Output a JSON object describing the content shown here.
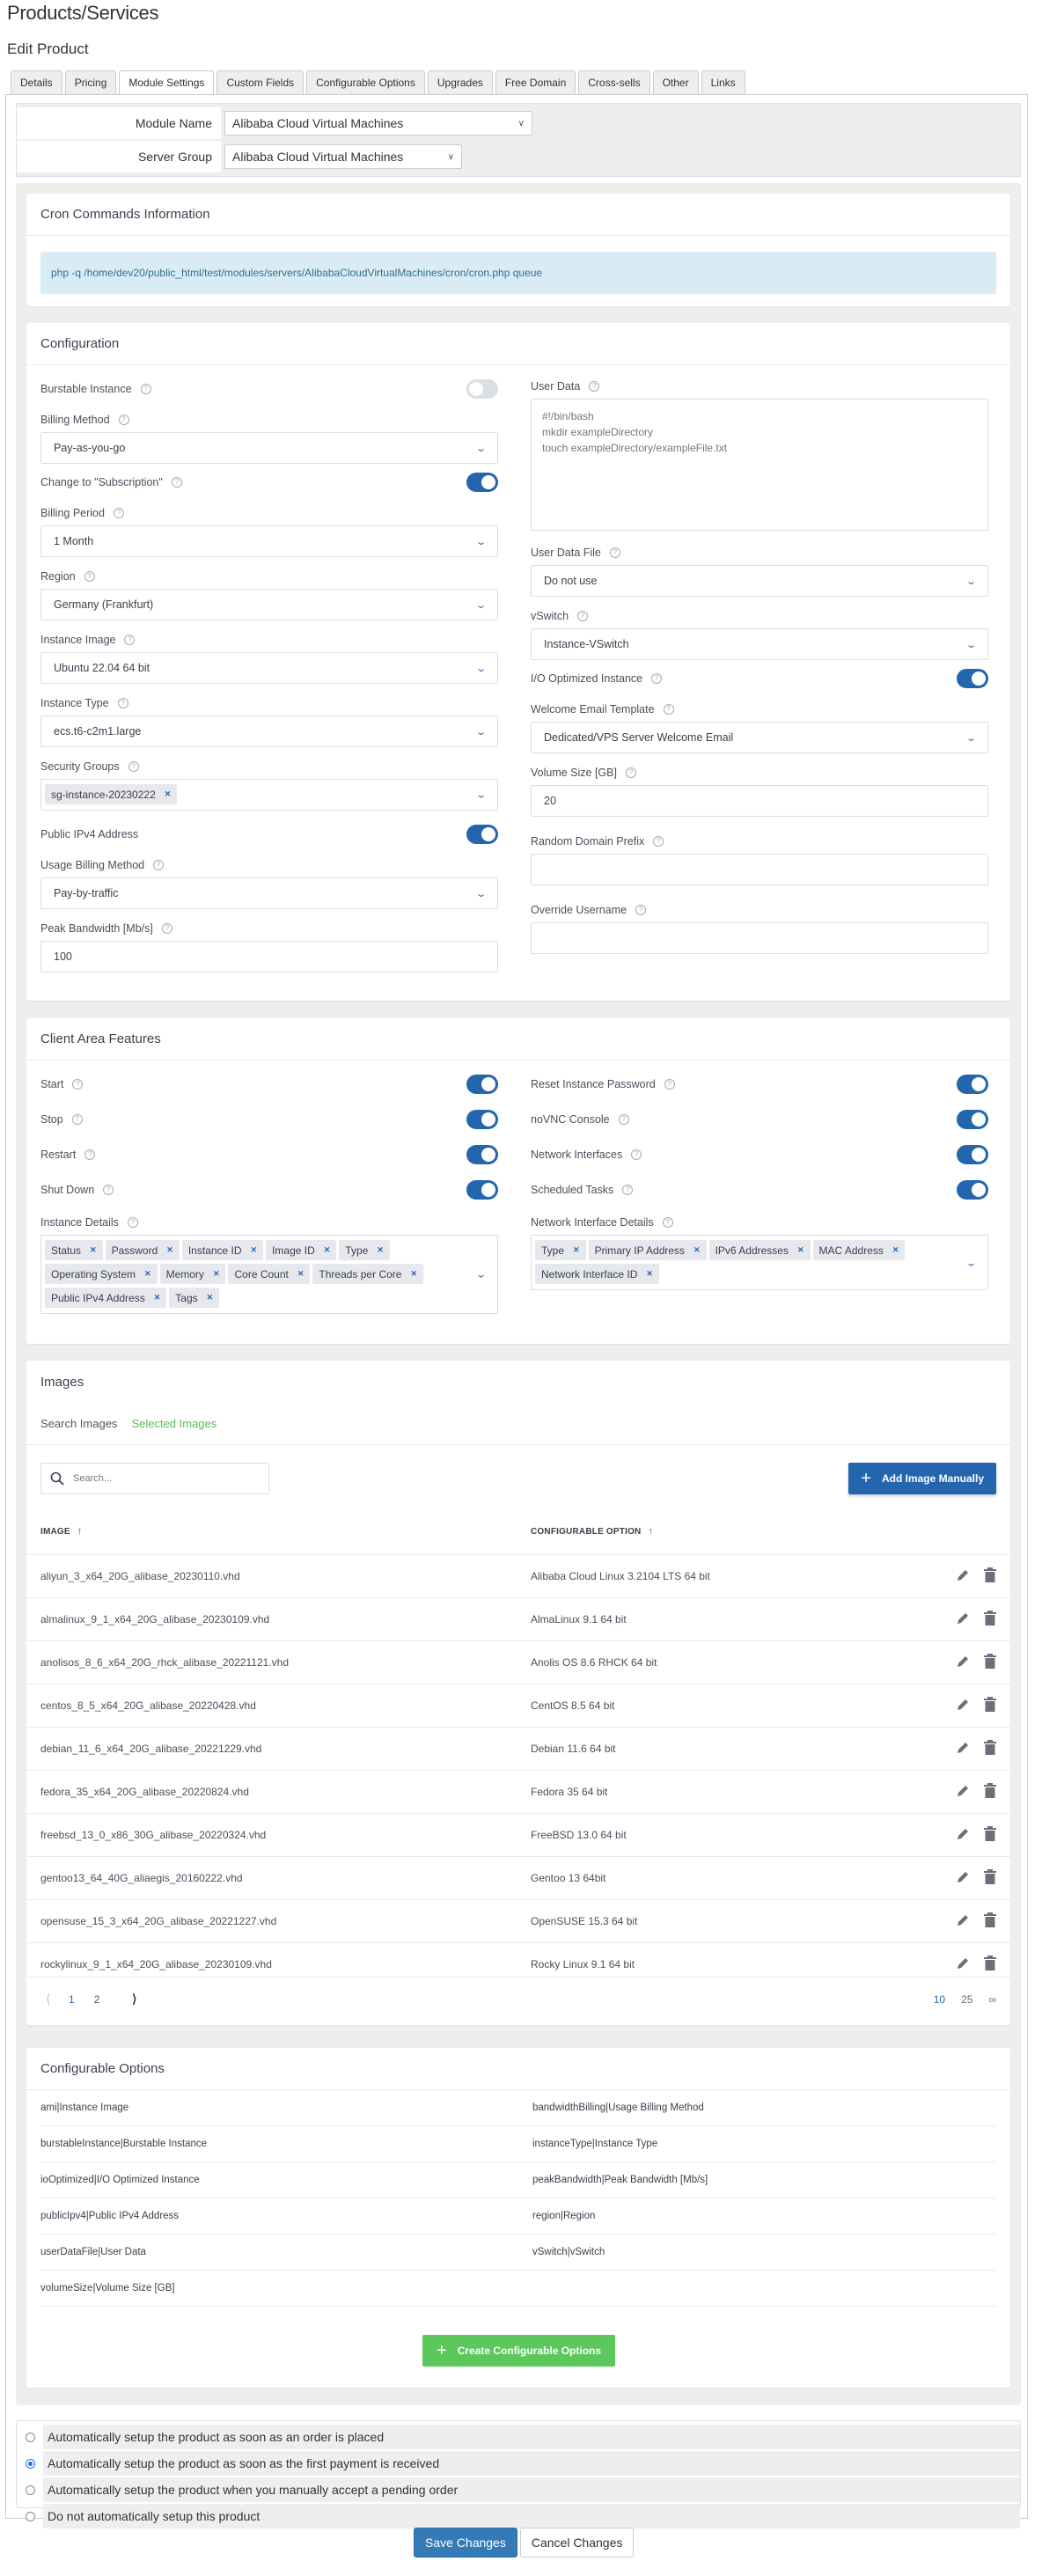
{
  "header": {
    "title": "Products/Services",
    "subtitle": "Edit Product"
  },
  "tabs": [
    {
      "label": "Details"
    },
    {
      "label": "Pricing"
    },
    {
      "label": "Module Settings",
      "active": true
    },
    {
      "label": "Custom Fields"
    },
    {
      "label": "Configurable Options"
    },
    {
      "label": "Upgrades"
    },
    {
      "label": "Free Domain"
    },
    {
      "label": "Cross-sells"
    },
    {
      "label": "Other"
    },
    {
      "label": "Links"
    }
  ],
  "module": {
    "module_name_label": "Module Name",
    "module_name_value": "Alibaba Cloud Virtual Machines",
    "server_group_label": "Server Group",
    "server_group_value": "Alibaba Cloud Virtual Machines"
  },
  "cron": {
    "title": "Cron Commands Information",
    "command": "php -q /home/dev20/public_html/test/modules/servers/AlibabaCloudVirtualMachines/cron/cron.php queue"
  },
  "configuration": {
    "title": "Configuration",
    "burstable": {
      "label": "Burstable Instance",
      "on": false
    },
    "billing_method": {
      "label": "Billing Method",
      "value": "Pay-as-you-go"
    },
    "change_subscription": {
      "label": "Change to \"Subscription\"",
      "on": true
    },
    "billing_period": {
      "label": "Billing Period",
      "value": "1 Month"
    },
    "region": {
      "label": "Region",
      "value": "Germany (Frankfurt)"
    },
    "instance_image": {
      "label": "Instance Image",
      "value": "Ubuntu 22.04 64 bit"
    },
    "instance_type": {
      "label": "Instance Type",
      "value": "ecs.t6-c2m1.large"
    },
    "security_groups": {
      "label": "Security Groups",
      "chips": [
        "sg-instance-20230222"
      ]
    },
    "public_ipv4": {
      "label": "Public IPv4 Address",
      "on": true
    },
    "usage_billing": {
      "label": "Usage Billing Method",
      "value": "Pay-by-traffic"
    },
    "peak_bandwidth": {
      "label": "Peak Bandwidth [Mb/s]",
      "value": "100"
    },
    "user_data": {
      "label": "User Data",
      "placeholder": "#!/bin/bash\nmkdir exampleDirectory\ntouch exampleDirectory/exampleFile.txt"
    },
    "user_data_file": {
      "label": "User Data File",
      "value": "Do not use"
    },
    "vswitch": {
      "label": "vSwitch",
      "value": "Instance-VSwitch"
    },
    "io_optimized": {
      "label": "I/O Optimized Instance",
      "on": true
    },
    "welcome_email": {
      "label": "Welcome Email Template",
      "value": "Dedicated/VPS Server Welcome Email"
    },
    "volume_size": {
      "label": "Volume Size [GB]",
      "value": "20"
    },
    "random_domain": {
      "label": "Random Domain Prefix",
      "value": ""
    },
    "override_username": {
      "label": "Override Username",
      "value": ""
    }
  },
  "client_area": {
    "title": "Client Area Features",
    "left_toggles": [
      {
        "label": "Start",
        "on": true
      },
      {
        "label": "Stop",
        "on": true
      },
      {
        "label": "Restart",
        "on": true
      },
      {
        "label": "Shut Down",
        "on": true
      }
    ],
    "right_toggles": [
      {
        "label": "Reset Instance Password",
        "on": true
      },
      {
        "label": "noVNC Console",
        "on": true
      },
      {
        "label": "Network Interfaces",
        "on": true
      },
      {
        "label": "Scheduled Tasks",
        "on": true
      }
    ],
    "instance_details": {
      "label": "Instance Details",
      "chips": [
        "Status",
        "Password",
        "Instance ID",
        "Image ID",
        "Type",
        "Operating System",
        "Memory",
        "Core Count",
        "Threads per Core",
        "Public IPv4 Address",
        "Tags"
      ]
    },
    "network_details": {
      "label": "Network Interface Details",
      "chips": [
        "Type",
        "Primary IP Address",
        "IPv6 Addresses",
        "MAC Address",
        "Network Interface ID"
      ]
    }
  },
  "images": {
    "title": "Images",
    "tabs": [
      {
        "label": "Search Images"
      },
      {
        "label": "Selected Images",
        "active": true
      }
    ],
    "search_placeholder": "Search...",
    "add_button": "Add Image Manually",
    "col_image": "IMAGE",
    "col_option": "CONFIGURABLE OPTION",
    "rows": [
      {
        "image": "aliyun_3_x64_20G_alibase_20230110.vhd",
        "option": "Alibaba Cloud Linux 3.2104 LTS 64 bit"
      },
      {
        "image": "almalinux_9_1_x64_20G_alibase_20230109.vhd",
        "option": "AlmaLinux 9.1 64 bit"
      },
      {
        "image": "anolisos_8_6_x64_20G_rhck_alibase_20221121.vhd",
        "option": "Anolis OS 8.6 RHCK 64 bit"
      },
      {
        "image": "centos_8_5_x64_20G_alibase_20220428.vhd",
        "option": "CentOS 8.5 64 bit"
      },
      {
        "image": "debian_11_6_x64_20G_alibase_20221229.vhd",
        "option": "Debian 11.6 64 bit"
      },
      {
        "image": "fedora_35_x64_20G_alibase_20220824.vhd",
        "option": "Fedora 35 64 bit"
      },
      {
        "image": "freebsd_13_0_x86_30G_alibase_20220324.vhd",
        "option": "FreeBSD 13.0 64 bit"
      },
      {
        "image": "gentoo13_64_40G_aliaegis_20160222.vhd",
        "option": "Gentoo 13 64bit"
      },
      {
        "image": "opensuse_15_3_x64_20G_alibase_20221227.vhd",
        "option": "OpenSUSE 15.3 64 bit"
      },
      {
        "image": "rockylinux_9_1_x64_20G_alibase_20230109.vhd",
        "option": "Rocky Linux 9.1 64 bit"
      }
    ],
    "pagination": {
      "pages": [
        "1",
        "2"
      ],
      "current": "1",
      "page_sizes": [
        "10",
        "25",
        "∞"
      ],
      "current_size": "10"
    }
  },
  "configurable_options": {
    "title": "Configurable Options",
    "items": [
      "ami|Instance Image",
      "bandwidthBilling|Usage Billing Method",
      "burstableInstance|Burstable Instance",
      "instanceType|Instance Type",
      "ioOptimized|I/O Optimized Instance",
      "peakBandwidth|Peak Bandwidth [Mb/s]",
      "publicIpv4|Public IPv4 Address",
      "region|Region",
      "userDataFile|User Data",
      "vSwitch|vSwitch",
      "volumeSize|Volume Size [GB]"
    ],
    "create_button": "Create Configurable Options"
  },
  "setup_options": [
    {
      "label": "Automatically setup the product as soon as an order is placed",
      "checked": false
    },
    {
      "label": "Automatically setup the product as soon as the first payment is received",
      "checked": true
    },
    {
      "label": "Automatically setup the product when you manually accept a pending order",
      "checked": false
    },
    {
      "label": "Do not automatically setup this product",
      "checked": false
    }
  ],
  "footer": {
    "save": "Save Changes",
    "cancel": "Cancel Changes"
  },
  "colors": {
    "primary": "#2466ae",
    "success": "#5cc85c",
    "info_bg": "#d9ecf5",
    "save": "#337ab7"
  }
}
